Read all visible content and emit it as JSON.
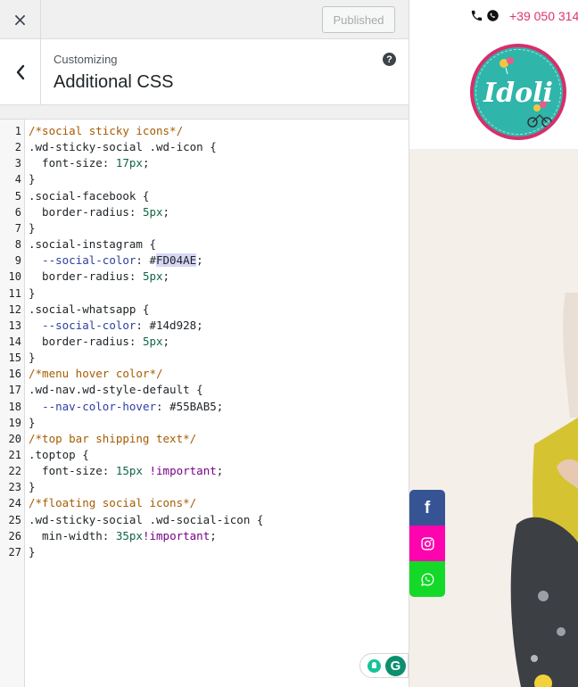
{
  "topbar": {
    "close_glyph": "×",
    "publish_label": "Published"
  },
  "section": {
    "breadcrumb": "Customizing",
    "title": "Additional CSS",
    "help_glyph": "?"
  },
  "editor": {
    "lines": [
      {
        "n": "1",
        "segs": [
          {
            "t": "/*social sticky icons*/",
            "c": "c-comment"
          }
        ]
      },
      {
        "n": "2",
        "segs": [
          {
            "t": ".wd-sticky-social .wd-icon {",
            "c": "c-sel"
          }
        ]
      },
      {
        "n": "3",
        "segs": [
          {
            "t": "  font-size",
            "c": "c-prop"
          },
          {
            "t": ": ",
            "c": "c-sel"
          },
          {
            "t": "17px",
            "c": "c-num"
          },
          {
            "t": ";",
            "c": "c-sel"
          }
        ]
      },
      {
        "n": "4",
        "segs": [
          {
            "t": "}",
            "c": "c-sel"
          }
        ]
      },
      {
        "n": "5",
        "segs": [
          {
            "t": ".social-facebook {",
            "c": "c-sel"
          }
        ]
      },
      {
        "n": "6",
        "segs": [
          {
            "t": "  border-radius",
            "c": "c-prop"
          },
          {
            "t": ": ",
            "c": "c-sel"
          },
          {
            "t": "5px",
            "c": "c-num"
          },
          {
            "t": ";",
            "c": "c-sel"
          }
        ]
      },
      {
        "n": "7",
        "segs": [
          {
            "t": "}",
            "c": "c-sel"
          }
        ]
      },
      {
        "n": "8",
        "segs": [
          {
            "t": ".social-instagram {",
            "c": "c-sel"
          }
        ]
      },
      {
        "n": "9",
        "segs": [
          {
            "t": "  ",
            "c": "c-sel"
          },
          {
            "t": "--social-color",
            "c": "c-var"
          },
          {
            "t": ": #",
            "c": "c-sel"
          },
          {
            "t": "FD04AE",
            "c": "c-hl"
          },
          {
            "t": ";",
            "c": "c-sel"
          }
        ]
      },
      {
        "n": "10",
        "segs": [
          {
            "t": "  border-radius",
            "c": "c-prop"
          },
          {
            "t": ": ",
            "c": "c-sel"
          },
          {
            "t": "5px",
            "c": "c-num"
          },
          {
            "t": ";",
            "c": "c-sel"
          }
        ]
      },
      {
        "n": "11",
        "segs": [
          {
            "t": "}",
            "c": "c-sel"
          }
        ]
      },
      {
        "n": "12",
        "segs": [
          {
            "t": ".social-whatsapp {",
            "c": "c-sel"
          }
        ]
      },
      {
        "n": "13",
        "segs": [
          {
            "t": "  ",
            "c": "c-sel"
          },
          {
            "t": "--social-color",
            "c": "c-var"
          },
          {
            "t": ": ",
            "c": "c-sel"
          },
          {
            "t": "#14d928",
            "c": "c-hex"
          },
          {
            "t": ";",
            "c": "c-sel"
          }
        ]
      },
      {
        "n": "14",
        "segs": [
          {
            "t": "  border-radius",
            "c": "c-prop"
          },
          {
            "t": ": ",
            "c": "c-sel"
          },
          {
            "t": "5px",
            "c": "c-num"
          },
          {
            "t": ";",
            "c": "c-sel"
          }
        ]
      },
      {
        "n": "15",
        "segs": [
          {
            "t": "}",
            "c": "c-sel"
          }
        ]
      },
      {
        "n": "16",
        "segs": [
          {
            "t": "/*menu hover color*/",
            "c": "c-comment"
          }
        ]
      },
      {
        "n": "17",
        "segs": [
          {
            "t": ".wd-nav.wd-style-default {",
            "c": "c-sel"
          }
        ]
      },
      {
        "n": "18",
        "segs": [
          {
            "t": "  ",
            "c": "c-sel"
          },
          {
            "t": "--nav-color-hover",
            "c": "c-var"
          },
          {
            "t": ": ",
            "c": "c-sel"
          },
          {
            "t": "#55BAB5",
            "c": "c-hex"
          },
          {
            "t": ";",
            "c": "c-sel"
          }
        ]
      },
      {
        "n": "19",
        "segs": [
          {
            "t": "}",
            "c": "c-sel"
          }
        ]
      },
      {
        "n": "20",
        "segs": [
          {
            "t": "/*top bar shipping text*/",
            "c": "c-comment"
          }
        ]
      },
      {
        "n": "21",
        "segs": [
          {
            "t": ".toptop {",
            "c": "c-sel"
          }
        ]
      },
      {
        "n": "22",
        "segs": [
          {
            "t": "  font-size",
            "c": "c-prop"
          },
          {
            "t": ": ",
            "c": "c-sel"
          },
          {
            "t": "15px",
            "c": "c-num"
          },
          {
            "t": " ",
            "c": "c-sel"
          },
          {
            "t": "!important",
            "c": "c-imp"
          },
          {
            "t": ";",
            "c": "c-sel"
          }
        ]
      },
      {
        "n": "23",
        "segs": [
          {
            "t": "}",
            "c": "c-sel"
          }
        ]
      },
      {
        "n": "24",
        "segs": [
          {
            "t": "/*floating social icons*/",
            "c": "c-comment"
          }
        ]
      },
      {
        "n": "25",
        "segs": [
          {
            "t": ".wd-sticky-social .wd-social-icon {",
            "c": "c-sel"
          }
        ]
      },
      {
        "n": "26",
        "segs": [
          {
            "t": "  min-width",
            "c": "c-prop"
          },
          {
            "t": ": ",
            "c": "c-sel"
          },
          {
            "t": "35px",
            "c": "c-num"
          },
          {
            "t": "!important",
            "c": "c-imp"
          },
          {
            "t": ";",
            "c": "c-sel"
          }
        ]
      },
      {
        "n": "27",
        "segs": [
          {
            "t": "}",
            "c": "c-sel"
          }
        ]
      }
    ]
  },
  "grammarly": {
    "g_letter": "G"
  },
  "preview": {
    "phone": "+39 050 314",
    "logo_text": "Idoli",
    "social": [
      {
        "name": "facebook",
        "glyph": "f",
        "color": "#365493"
      },
      {
        "name": "instagram",
        "icon": "instagram-icon",
        "color": "#FD04AE"
      },
      {
        "name": "whatsapp",
        "icon": "whatsapp-icon",
        "color": "#14d928"
      }
    ]
  }
}
